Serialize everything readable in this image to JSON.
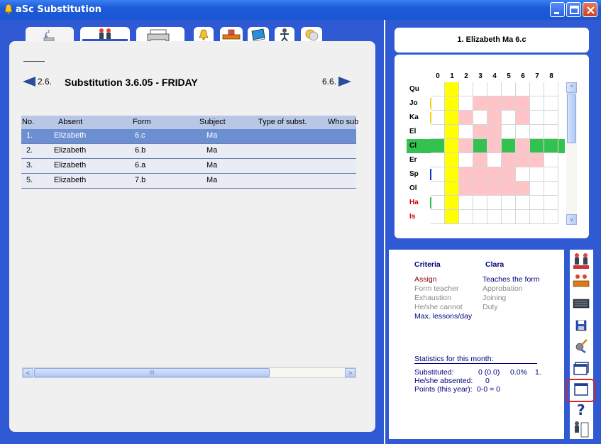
{
  "window": {
    "title": "aSc Substitution",
    "minimize_label": "_",
    "maximize_label": "□",
    "close_label": "×"
  },
  "tabs": [
    {
      "icon": "sleep-icon"
    },
    {
      "icon": "teachers-icon"
    },
    {
      "icon": "printer-icon"
    },
    {
      "icon": "bell-icon"
    },
    {
      "icon": "desk-icon"
    },
    {
      "icon": "book-icon"
    },
    {
      "icon": "person-icon"
    },
    {
      "icon": "coins-icon"
    }
  ],
  "nav": {
    "prev_label": "2.6.",
    "next_label": "6.6.",
    "heading": "Substitution 3.6.05 - FRIDAY"
  },
  "table": {
    "headers": [
      "No.",
      "Absent",
      "Form",
      "Subject",
      "Type of subst.",
      "Who sub"
    ],
    "rows": [
      [
        "1.",
        "Elizabeth",
        "6.c",
        "Ma"
      ],
      [
        "2.",
        "Elizabeth",
        "6.b",
        "Ma"
      ],
      [
        "3.",
        "Elizabeth",
        "6.a",
        "Ma"
      ],
      [
        "5.",
        "Elizabeth",
        "7.b",
        "Ma"
      ]
    ]
  },
  "scroll": {
    "thumb_grip": "III",
    "left_arrow": "<",
    "right_arrow": ">",
    "up_arrow": "^",
    "down_arrow": "v"
  },
  "right": {
    "name_box": "1. Elizabeth Ma 6.c"
  },
  "grid": {
    "periods": [
      "0",
      "1",
      "2",
      "3",
      "4",
      "5",
      "6",
      "7",
      "8"
    ],
    "teachers": [
      {
        "label": "Qu",
        "color": "#000000"
      },
      {
        "label": "Jo",
        "color": "#000000"
      },
      {
        "label": "Ka",
        "color": "#000000"
      },
      {
        "label": "El",
        "color": "#000000"
      },
      {
        "label": "Cl",
        "color": "#000000"
      },
      {
        "label": "Er",
        "color": "#000000"
      },
      {
        "label": "Sp",
        "color": "#000000"
      },
      {
        "label": "Ol",
        "color": "#000000"
      },
      {
        "label": "Ha",
        "color": "#d00000"
      },
      {
        "label": "Is",
        "color": "#d00000"
      }
    ],
    "busy_color": "#ffc4c8",
    "selected_period_color": "#ffff00",
    "selected_row_color": "#33c14f"
  },
  "criteria": {
    "header_left": "Criteria",
    "header_right": "Clara",
    "left_items": [
      {
        "text": "Assign",
        "color": "#8b0000"
      },
      {
        "text": "Form teacher",
        "color": "#8a8a8a"
      },
      {
        "text": "Exhaustion",
        "color": "#8a8a8a"
      },
      {
        "text": "He/she cannot",
        "color": "#8a8a8a"
      },
      {
        "text": "Max. lessons/day",
        "color": "#000080"
      }
    ],
    "right_items": [
      {
        "text": "Teaches the form",
        "color": "#000080"
      },
      {
        "text": "Approbation",
        "color": "#8a8a8a"
      },
      {
        "text": "Joining",
        "color": "#8a8a8a"
      },
      {
        "text": "Duty",
        "color": "#8a8a8a"
      }
    ],
    "stats_title": "Statistics for this month:",
    "stats": [
      {
        "label": "Substituted:",
        "value": "0 (0.0)",
        "pct": "0.0%",
        "extra": "1."
      },
      {
        "label": "He/she absented:",
        "value": "0"
      },
      {
        "label": "Points (this year):",
        "value": "0-0 = 0"
      }
    ]
  },
  "side_toolbar": [
    "teachers-group-icon",
    "classroom-icon",
    "board-icon",
    "save-icon",
    "settings-icon",
    "windows-icon",
    "window-icon",
    "help-icon",
    "exit-icon"
  ]
}
